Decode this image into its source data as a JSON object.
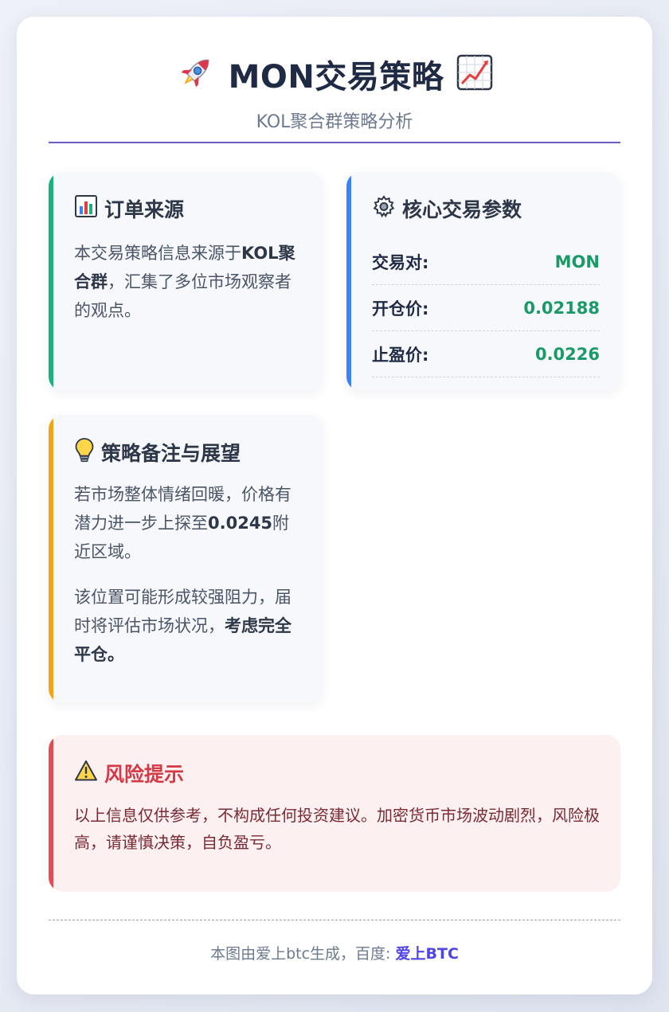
{
  "header": {
    "title": "MON交易策略",
    "subtitle": "KOL聚合群策略分析",
    "left_icon": "rocket-icon",
    "right_icon": "chart-increasing-icon"
  },
  "source_panel": {
    "icon": "bar-chart-icon",
    "title": "订单来源",
    "text_prefix": "本交易策略信息来源于",
    "text_bold": "KOL聚合群",
    "text_suffix": "，汇集了多位市场观察者的观点。"
  },
  "params_panel": {
    "icon": "gear-icon",
    "title": "核心交易参数",
    "rows": [
      {
        "label": "交易对:",
        "value": "MON"
      },
      {
        "label": "开仓价:",
        "value": "0.02188"
      },
      {
        "label": "止盈价:",
        "value": "0.0226"
      }
    ]
  },
  "notes_panel": {
    "icon": "lightbulb-icon",
    "title": "策略备注与展望",
    "para1_prefix": "若市场整体情绪回暖，价格有潜力进一步上探至",
    "para1_bold": "0.0245",
    "para1_suffix": "附近区域。",
    "para2_prefix": "该位置可能形成较强阻力，届时将评估市场状况，",
    "para2_bold": "考虑完全平仓。"
  },
  "risk_panel": {
    "icon": "warning-icon",
    "title": "风险提示",
    "text": "以上信息仅供参考，不构成任何投资建议。加密货币市场波动剧烈，风险极高，请谨慎决策，自负盈亏。"
  },
  "footer": {
    "text": "本图由爱上btc生成，百度: ",
    "brand": "爱上BTC"
  },
  "colors": {
    "accent_divider": "#6a5bc7",
    "source_accent": "#19b27f",
    "params_accent": "#3b82f6",
    "notes_accent": "#f0a519",
    "risk_accent": "#e34b56",
    "value_green": "#1a9a66",
    "brand": "#4f46e5"
  }
}
